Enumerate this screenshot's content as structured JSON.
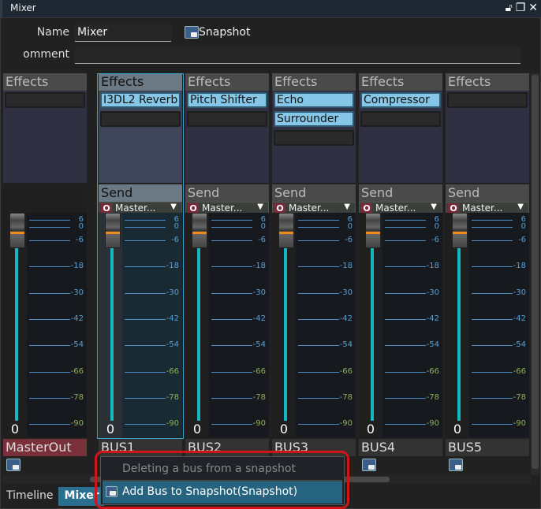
{
  "window": {
    "title": "Mixer",
    "icons": [
      "lock-icon",
      "restore-icon",
      "close-icon"
    ]
  },
  "form": {
    "name_label": "Name",
    "name_value": "Mixer",
    "comment_label": "omment",
    "comment_value": "",
    "snapshot_label": "Snapshot"
  },
  "scale": [
    {
      "db": "6"
    },
    {
      "db": "0"
    },
    {
      "db": "-6"
    },
    {
      "db": "-18"
    },
    {
      "db": "-30"
    },
    {
      "db": "-42"
    },
    {
      "db": "-54"
    },
    {
      "db": "-66"
    },
    {
      "db": "-78"
    },
    {
      "db": "-90"
    }
  ],
  "strips": [
    {
      "name": "MasterOut",
      "effects_label": "Effects",
      "effects": [],
      "send_label": "",
      "send_target": "",
      "value": "0",
      "master": true
    },
    {
      "name": "BUS1",
      "effects_label": "Effects",
      "effects": [
        "I3DL2 Reverb"
      ],
      "send_label": "Send",
      "send_target": "Master...",
      "value": "0",
      "selected": true
    },
    {
      "name": "BUS2",
      "effects_label": "Effects",
      "effects": [
        "Pitch Shifter"
      ],
      "send_label": "Send",
      "send_target": "Master...",
      "value": "0"
    },
    {
      "name": "BUS3",
      "effects_label": "Effects",
      "effects": [
        "Echo",
        "Surrounder"
      ],
      "send_label": "Send",
      "send_target": "Master...",
      "value": "0"
    },
    {
      "name": "BUS4",
      "effects_label": "Effects",
      "effects": [
        "Compressor"
      ],
      "send_label": "Send",
      "send_target": "Master...",
      "value": "0"
    },
    {
      "name": "BUS5",
      "effects_label": "Effects",
      "effects": [],
      "send_label": "Send",
      "send_target": "Master...",
      "value": "0"
    }
  ],
  "tabs": [
    {
      "label": "Timeline"
    },
    {
      "label": "Mixer",
      "active": true
    }
  ],
  "context_menu": {
    "items": [
      {
        "label": "Deleting a bus from a snapshot",
        "disabled": true
      },
      {
        "label": "Add Bus to Snapshot(Snapshot)",
        "highlighted": true
      }
    ]
  },
  "colors": {
    "accent": "#2a6f8f",
    "effect_on": "#86c6e6",
    "fader_track": "#16b8c0",
    "fader_mark": "#f08a1c",
    "master": "#7a3038",
    "highlight_outline": "#d0141a"
  }
}
